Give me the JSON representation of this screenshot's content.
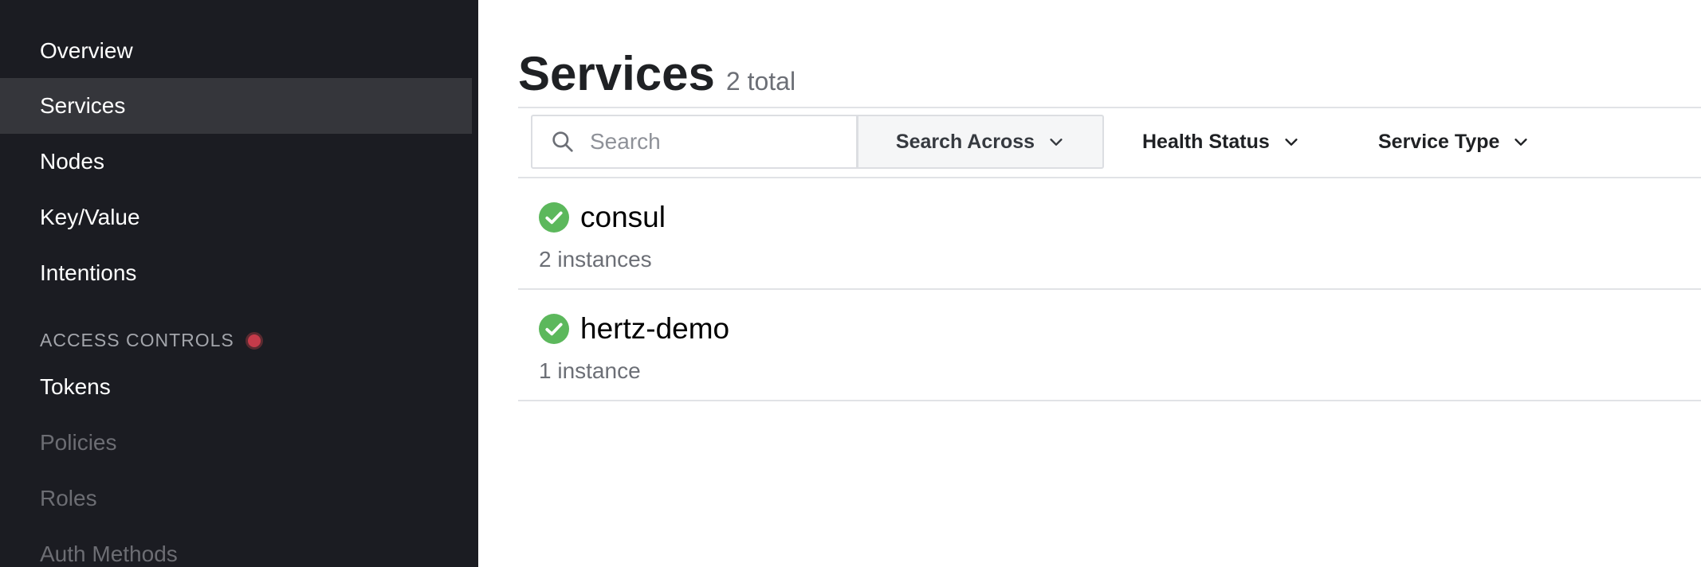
{
  "sidebar": {
    "items": [
      {
        "label": "Overview"
      },
      {
        "label": "Services"
      },
      {
        "label": "Nodes"
      },
      {
        "label": "Key/Value"
      },
      {
        "label": "Intentions"
      }
    ],
    "access_controls": {
      "heading": "ACCESS CONTROLS",
      "items": [
        {
          "label": "Tokens"
        },
        {
          "label": "Policies"
        },
        {
          "label": "Roles"
        },
        {
          "label": "Auth Methods"
        }
      ]
    }
  },
  "main": {
    "title": "Services",
    "count": "2 total",
    "search": {
      "placeholder": "Search",
      "value": ""
    },
    "filters": {
      "search_across": "Search Across",
      "health_status": "Health Status",
      "service_type": "Service Type"
    },
    "services": [
      {
        "name": "consul",
        "instances": "2 instances",
        "health": "passing"
      },
      {
        "name": "hertz-demo",
        "instances": "1 instance",
        "health": "passing"
      }
    ]
  },
  "colors": {
    "sidebar_bg": "#1b1c22",
    "sidebar_active": "#35363b",
    "health_passing": "#5cb85c",
    "alert": "#c53b4a"
  },
  "icons": {
    "search": "search-icon",
    "chevron": "chevron-down-icon",
    "health": "check-circle-icon",
    "alert": "alert-dot-icon"
  }
}
